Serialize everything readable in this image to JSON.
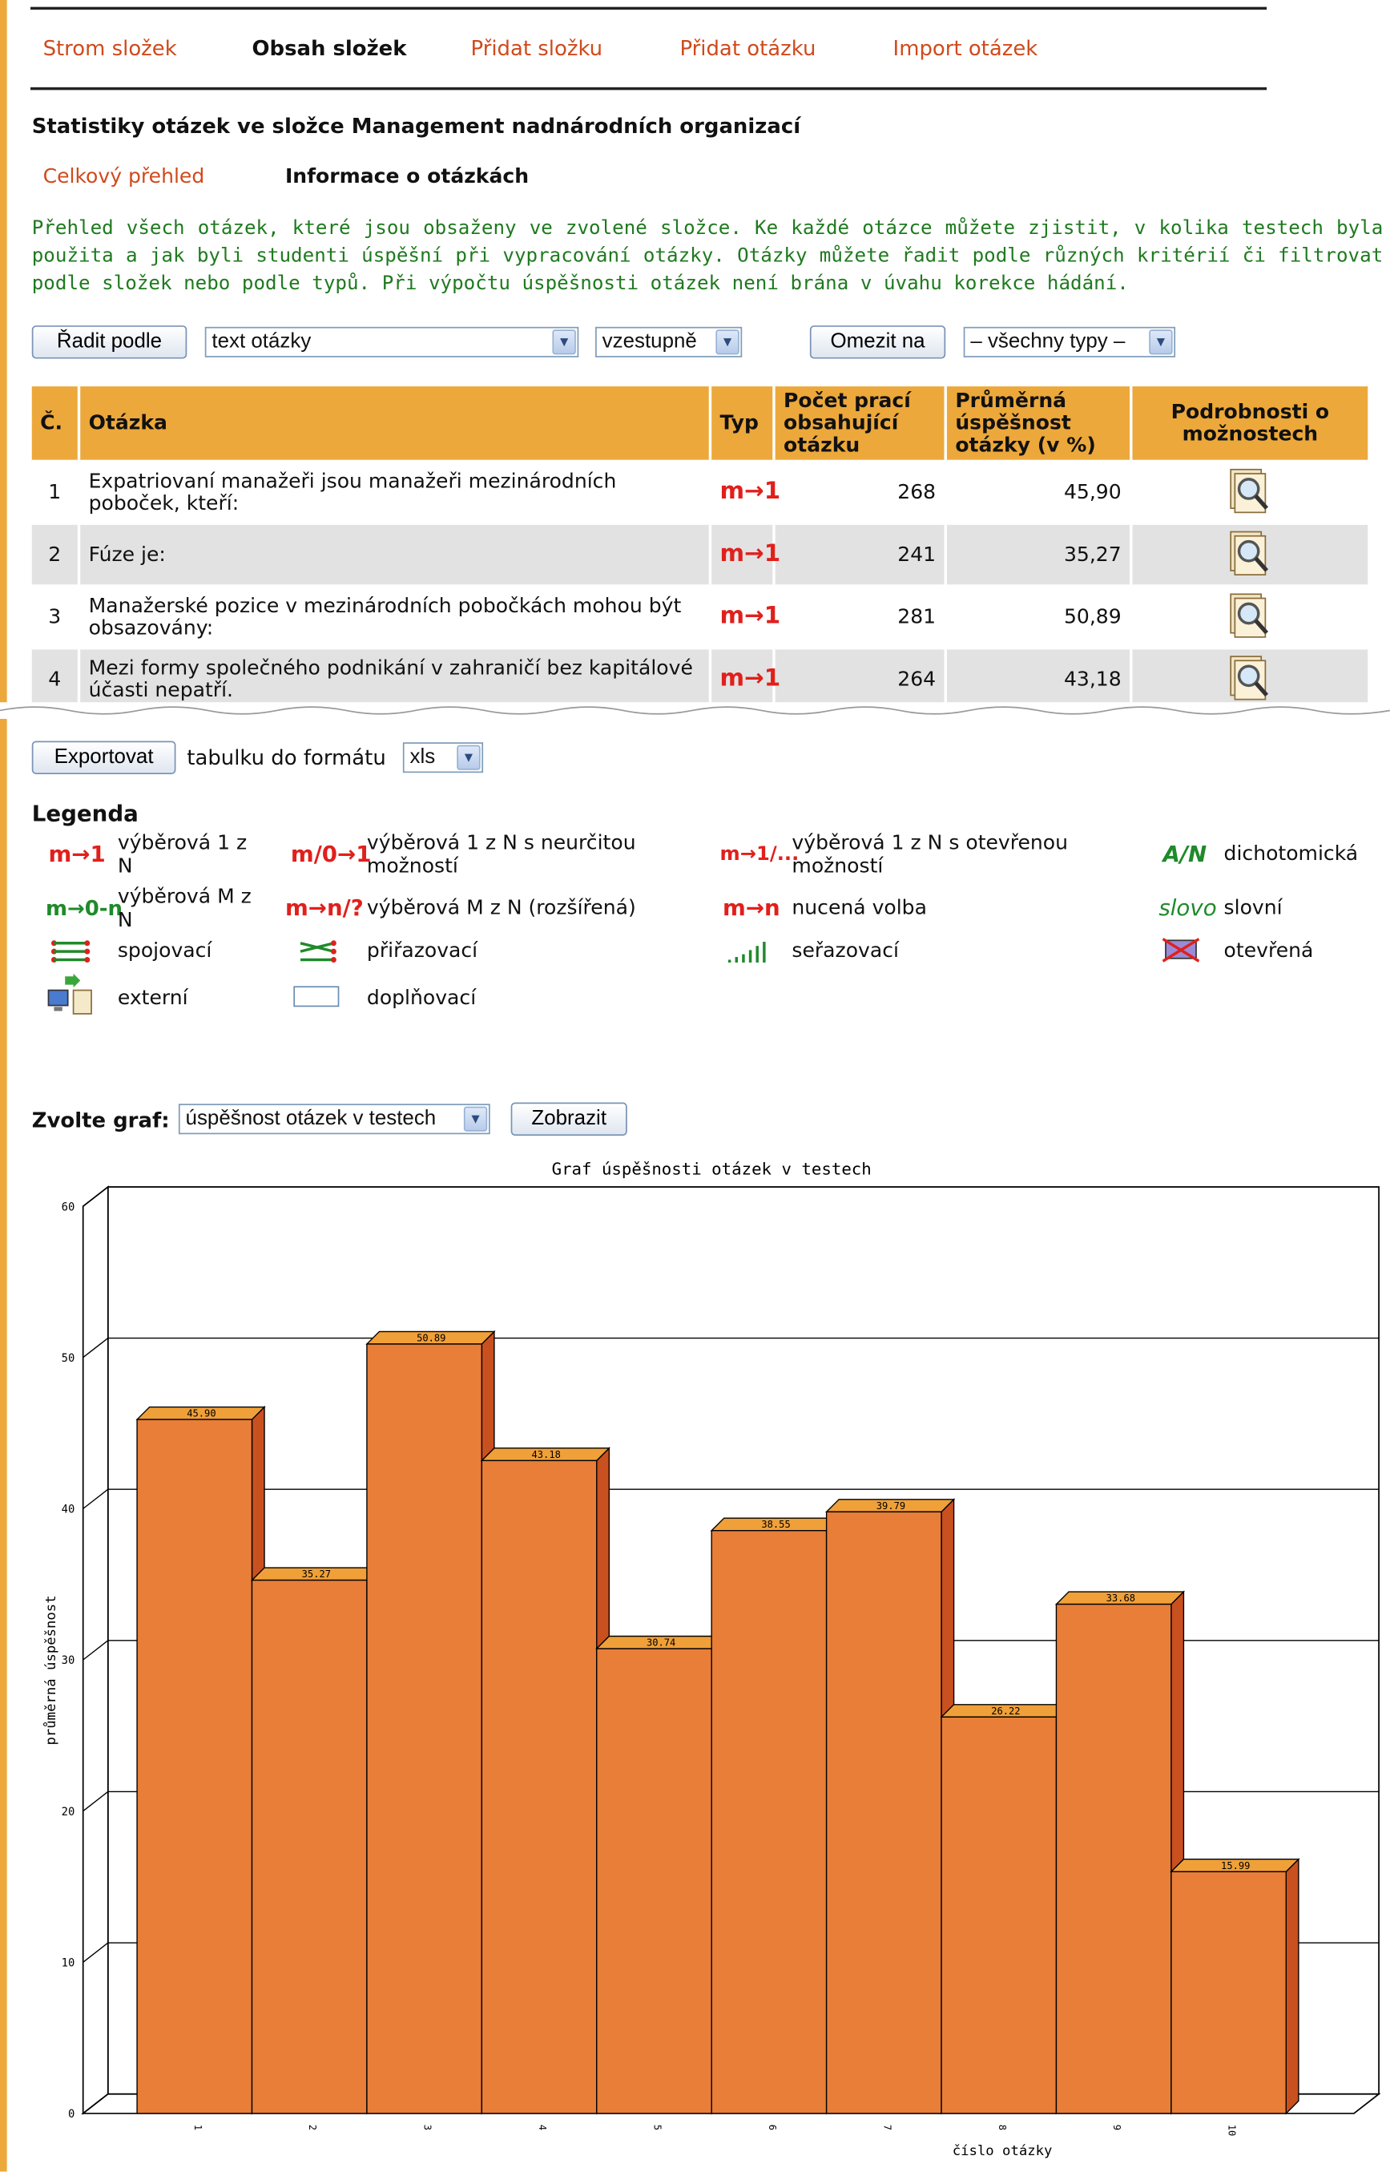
{
  "nav": {
    "tabs": [
      "Strom složek",
      "Obsah složek",
      "Přidat složku",
      "Přidat otázku",
      "Import otázek"
    ],
    "active_index": 1
  },
  "page_title": "Statistiky otázek ve složce Management nadnárodních organizací",
  "subtabs": [
    "Celkový přehled",
    "Informace o otázkách"
  ],
  "intro": "Přehled všech otázek, které jsou obsaženy ve zvolené složce. Ke každé otázce můžete zjistit, v kolika testech byla použita a jak byli studenti úspěšní při vypracování otázky. Otázky můžete řadit podle různých kritérií či filtrovat podle složek nebo podle typů. Při výpočtu úspěšnosti otázek není brána v úvahu korekce hádání.",
  "controls": {
    "sort_button": "Řadit podle",
    "sort_field": "text otázky",
    "sort_order": "vzestupně",
    "limit_button": "Omezit na",
    "limit_value": "– všechny typy –"
  },
  "table": {
    "headers": [
      "Č.",
      "Otázka",
      "Typ",
      "Počet prací obsahující otázku",
      "Průměrná úspěšnost otázky (v %)",
      "Podrobnosti o možnostech"
    ],
    "rows": [
      {
        "no": "1",
        "question": "Expatriovaní manažeři jsou manažeři mezinárodních poboček, kteří:",
        "type": "m→1",
        "count": "268",
        "success": "45,90"
      },
      {
        "no": "2",
        "question": "Fúze je:",
        "type": "m→1",
        "count": "241",
        "success": "35,27"
      },
      {
        "no": "3",
        "question": "Manažerské pozice v mezinárodních pobočkách mohou být obsazovány:",
        "type": "m→1",
        "count": "281",
        "success": "50,89"
      },
      {
        "no": "4",
        "question": "Mezi formy společného podnikání v zahraničí bez kapitálové účasti nepatří.",
        "type": "m→1",
        "count": "264",
        "success": "43,18"
      }
    ]
  },
  "export": {
    "button": "Exportovat",
    "text": "tabulku do formátu",
    "format": "xls"
  },
  "legend": {
    "title": "Legenda",
    "items": [
      {
        "icon": "m→1",
        "label": "výběrová 1 z N"
      },
      {
        "icon": "m/0→1",
        "label": "výběrová 1 z N s neurčitou možností"
      },
      {
        "icon": "m→1/...",
        "label": "výběrová 1 z N s otevřenou možností"
      },
      {
        "icon": "A/N",
        "label": "dichotomická"
      },
      {
        "icon": "m→0-n",
        "label": "výběrová M z N"
      },
      {
        "icon": "m→n/?",
        "label": "výběrová M z N (rozšířená)"
      },
      {
        "icon": "m→n",
        "label": "nucená volba"
      },
      {
        "icon": "slovo",
        "label": "slovní"
      },
      {
        "icon": "spojovaci-icon",
        "label": "spojovací"
      },
      {
        "icon": "prirazovaci-icon",
        "label": "přiřazovací"
      },
      {
        "icon": "serazovaci-icon",
        "label": "seřazovací"
      },
      {
        "icon": "otevrena-icon",
        "label": "otevřená"
      },
      {
        "icon": "externi-icon",
        "label": "externí"
      },
      {
        "icon": "doplnovaci-icon",
        "label": "doplňovací"
      }
    ]
  },
  "chart_controls": {
    "label": "Zvolte graf:",
    "select": "úspěšnost otázek v testech",
    "button": "Zobrazit"
  },
  "chart_data": {
    "type": "bar",
    "title": "Graf úspěšnosti otázek v testech",
    "xlabel": "číslo otázky",
    "ylabel": "průměrná úspěšnost",
    "categories": [
      "1",
      "2",
      "3",
      "4",
      "5",
      "6",
      "7",
      "8",
      "9",
      "10"
    ],
    "values": [
      45.9,
      35.27,
      50.89,
      43.18,
      30.74,
      38.55,
      39.79,
      26.22,
      33.68,
      15.99
    ],
    "value_labels": [
      "45.90",
      "35.27",
      "50.89",
      "43.18",
      "30.74",
      "38.55",
      "39.79",
      "26.22",
      "33.68",
      "15.99"
    ],
    "ylim": [
      0,
      60
    ],
    "yticks": [
      0,
      10,
      20,
      30,
      40,
      50,
      60
    ],
    "grid": true,
    "bar_color": "#e87e38",
    "bar_side_color": "#c9501f",
    "bar_top_color": "#f0a038"
  }
}
